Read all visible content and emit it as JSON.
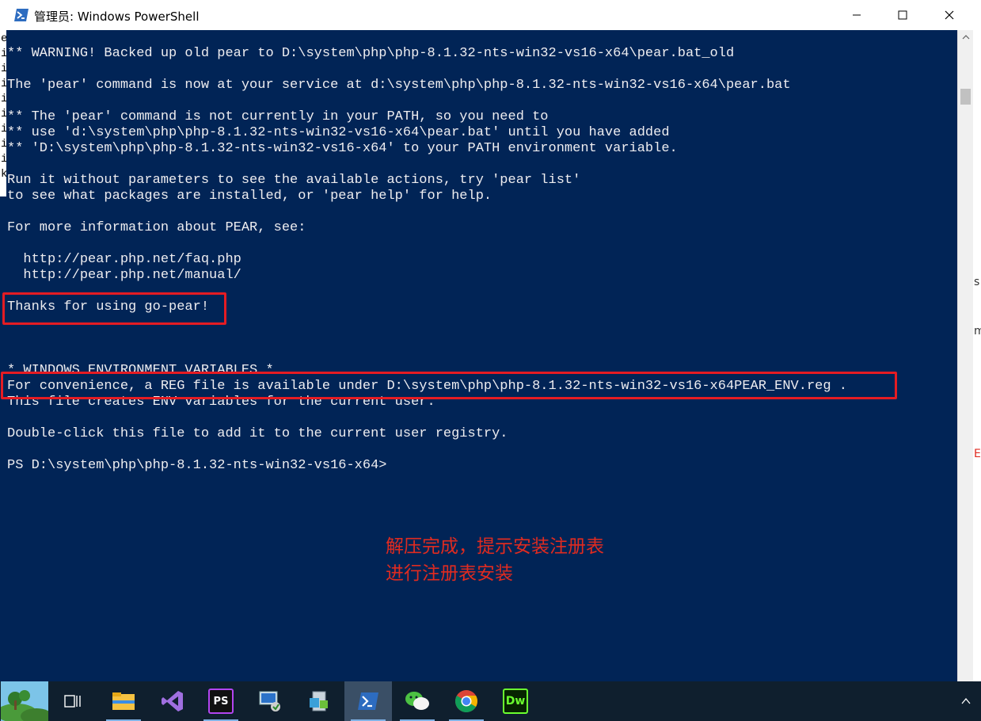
{
  "window": {
    "title": "管理员: Windows PowerShell",
    "minimize_label": "minimize",
    "maximize_label": "maximize",
    "close_label": "close"
  },
  "gutter_chars": [
    "k",
    "e",
    "i",
    "i",
    "i",
    "i",
    "i",
    "i",
    "i",
    "i",
    "k"
  ],
  "console_lines": [
    {
      "row": 1,
      "text": "** WARNING! Backed up old pear to D:\\system\\php\\php-8.1.32-nts-win32-vs16-x64\\pear.bat_old"
    },
    {
      "row": 3,
      "text": "The 'pear' command is now at your service at d:\\system\\php\\php-8.1.32-nts-win32-vs16-x64\\pear.bat"
    },
    {
      "row": 5,
      "text": "** The 'pear' command is not currently in your PATH, so you need to"
    },
    {
      "row": 6,
      "text": "** use 'd:\\system\\php\\php-8.1.32-nts-win32-vs16-x64\\pear.bat' until you have added"
    },
    {
      "row": 7,
      "text": "** 'D:\\system\\php\\php-8.1.32-nts-win32-vs16-x64' to your PATH environment variable."
    },
    {
      "row": 9,
      "text": "Run it without parameters to see the available actions, try 'pear list'"
    },
    {
      "row": 10,
      "text": "to see what packages are installed, or 'pear help' for help."
    },
    {
      "row": 12,
      "text": "For more information about PEAR, see:"
    },
    {
      "row": 14,
      "text": "  http://pear.php.net/faq.php"
    },
    {
      "row": 15,
      "text": "  http://pear.php.net/manual/"
    },
    {
      "row": 17,
      "text": "Thanks for using go-pear!"
    },
    {
      "row": 21,
      "text": "* WINDOWS ENVIRONMENT VARIABLES *"
    },
    {
      "row": 22,
      "text": "For convenience, a REG file is available under D:\\system\\php\\php-8.1.32-nts-win32-vs16-x64PEAR_ENV.reg ."
    },
    {
      "row": 23,
      "text": "This file creates ENV variables for the current user."
    },
    {
      "row": 25,
      "text": "Double-click this file to add it to the current user registry."
    },
    {
      "row": 27,
      "text": "PS D:\\system\\php\\php-8.1.32-nts-win32-vs16-x64>"
    }
  ],
  "annotation": {
    "line1": "解压完成，提示安装注册表",
    "line2": "进行注册表安装",
    "color": "#e02b20"
  },
  "right_strip_frags": [
    "s",
    "m",
    "E"
  ],
  "taskbar": {
    "items": [
      {
        "name": "task-view",
        "label": ""
      },
      {
        "name": "file-explorer",
        "label": ""
      },
      {
        "name": "visual-studio",
        "label": ""
      },
      {
        "name": "phpstorm",
        "label": "PS"
      },
      {
        "name": "remote-desktop",
        "label": ""
      },
      {
        "name": "app-installer",
        "label": ""
      },
      {
        "name": "powershell",
        "label": ""
      },
      {
        "name": "wechat",
        "label": ""
      },
      {
        "name": "chrome",
        "label": ""
      },
      {
        "name": "dreamweaver",
        "label": "Dw"
      }
    ],
    "tray_chevron": "^"
  },
  "colors": {
    "console_bg": "#012456",
    "console_fg": "#eeedf0",
    "highlight_box": "#e51c23"
  }
}
